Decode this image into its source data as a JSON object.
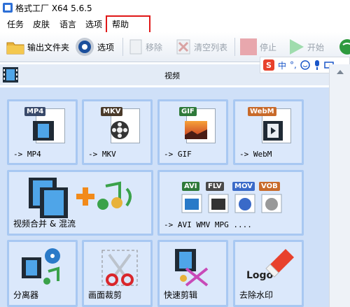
{
  "window": {
    "title": "格式工厂 X64 5.6.5"
  },
  "menu": {
    "items": [
      "任务",
      "皮肤",
      "语言",
      "选项",
      "帮助"
    ]
  },
  "toolbar": {
    "output_folder": "输出文件夹",
    "options": "选项",
    "remove": "移除",
    "clear_list": "清空列表",
    "stop": "停止",
    "start": "开始"
  },
  "ime": {
    "logo": "S",
    "lang": "中",
    "punct": "°,"
  },
  "section": {
    "label": "视频"
  },
  "tiles": [
    {
      "caption": "-> MP4",
      "tag": "MP4",
      "tag_color": "#3a4a6a"
    },
    {
      "caption": "-> MKV",
      "tag": "MKV",
      "tag_color": "#4a3a2a"
    },
    {
      "caption": "-> GIF",
      "tag": "GIF",
      "tag_color": "#2f7a3a"
    },
    {
      "caption": "-> WebM",
      "tag": "WebM",
      "tag_color": "#c86a2a"
    },
    {
      "caption": "视频合并 & 混流"
    },
    {
      "caption": "-> AVI WMV MPG ....",
      "tags": [
        "AVI",
        "FLV",
        "MOV",
        "VOB"
      ]
    },
    {
      "caption": "分离器"
    },
    {
      "caption": "画面裁剪"
    },
    {
      "caption": "快速剪辑"
    },
    {
      "caption": "去除水印",
      "logo_text": "Logo"
    }
  ]
}
